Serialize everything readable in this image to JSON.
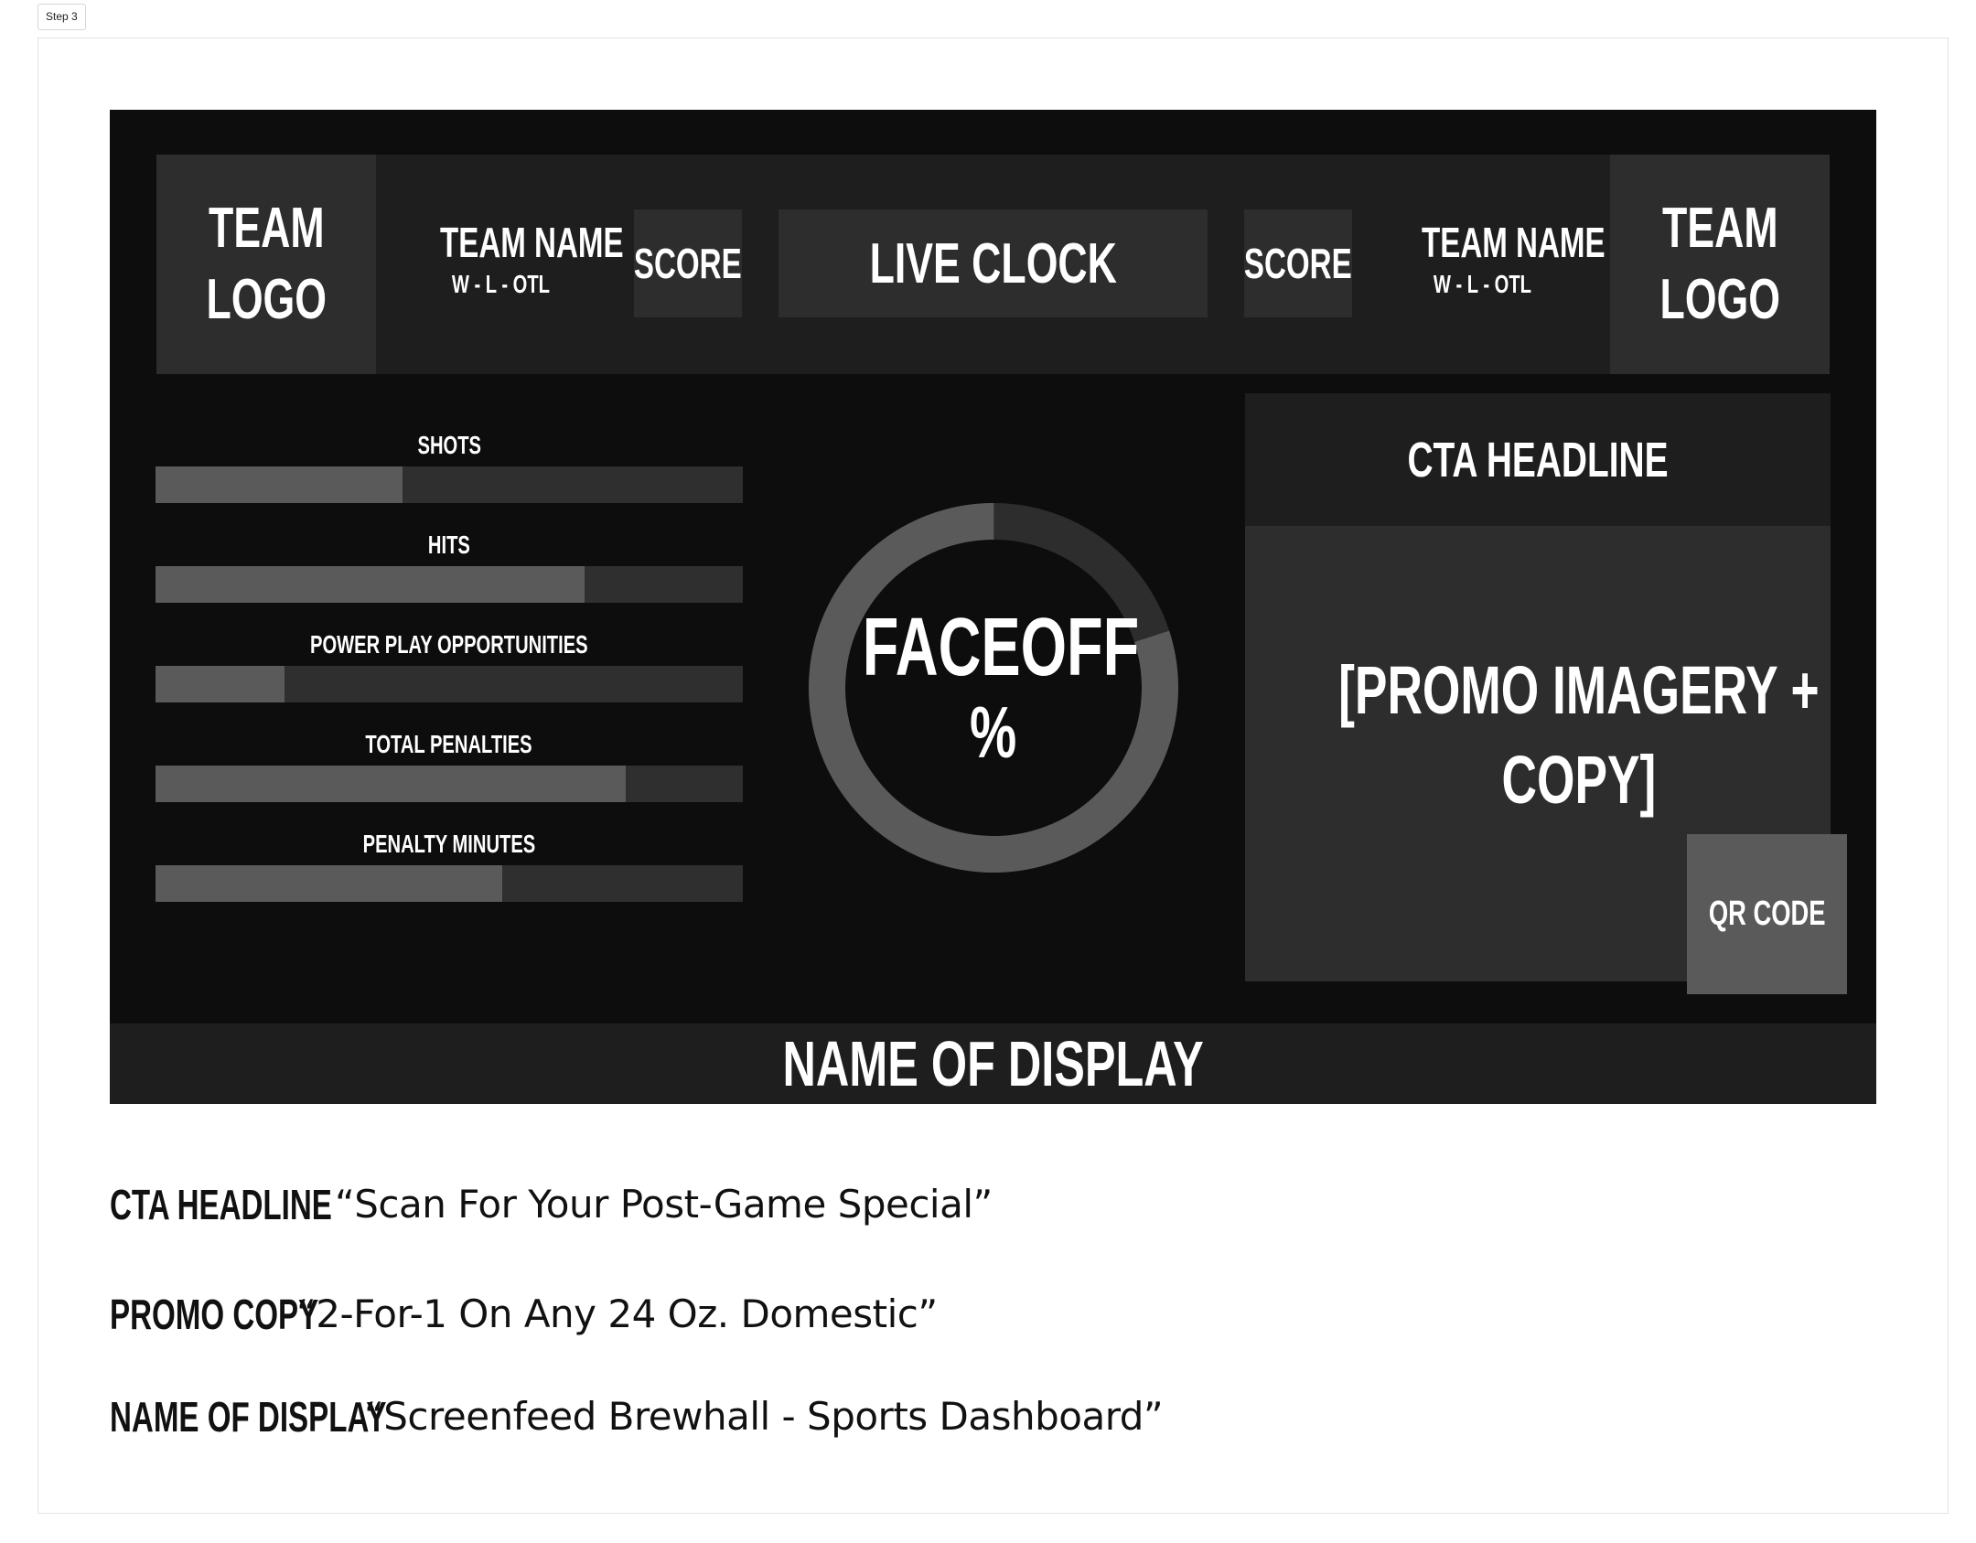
{
  "step_tag": "Step 3",
  "scoreboard": {
    "home": {
      "logo": "TEAM\nLOGO",
      "name": "TEAM NAME",
      "record": "W - L - OTL",
      "score": "SCORE"
    },
    "away": {
      "logo": "TEAM\nLOGO",
      "name": "TEAM NAME",
      "record": "W - L - OTL",
      "score": "SCORE"
    },
    "clock": "LIVE CLOCK"
  },
  "stats": [
    {
      "label": "SHOTS",
      "fill": 0.42
    },
    {
      "label": "HITS",
      "fill": 0.73
    },
    {
      "label": "POWER PLAY OPPORTUNITIES",
      "fill": 0.22
    },
    {
      "label": "TOTAL PENALTIES",
      "fill": 0.8
    },
    {
      "label": "PENALTY MINUTES",
      "fill": 0.59
    }
  ],
  "faceoff": {
    "title": "FACEOFF",
    "unit": "%",
    "value_fraction": 0.8
  },
  "cta": {
    "headline": "CTA HEADLINE",
    "promo": "[PROMO IMAGERY +\nCOPY]",
    "qr": "QR CODE"
  },
  "footer": {
    "name": "NAME OF DISPLAY"
  },
  "notes": [
    {
      "key": "CTA HEADLINE",
      "value": "“Scan For Your Post-Game Special”"
    },
    {
      "key": "PROMO COPY",
      "value": "“2-For-1 On Any 24 Oz. Domestic”"
    },
    {
      "key": "NAME OF DISPLAY",
      "value": "“Screenfeed Brewhall - Sports Dashboard”"
    }
  ],
  "colors": {
    "board_bg": "#0d0d0d",
    "panel_dark": "#1e1e1e",
    "panel_mid": "#2d2d2d",
    "bar_fill": "#5a5a5a",
    "text": "#ffffff"
  }
}
